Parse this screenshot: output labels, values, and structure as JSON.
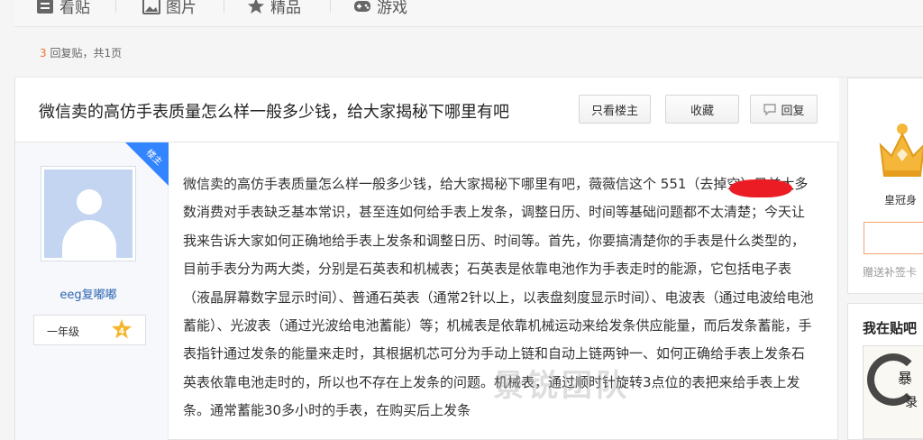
{
  "nav": {
    "items": [
      {
        "label": "看贴",
        "icon": "posts-icon"
      },
      {
        "label": "图片",
        "icon": "image-icon"
      },
      {
        "label": "精品",
        "icon": "star-icon"
      },
      {
        "label": "游戏",
        "icon": "gamepad-icon"
      }
    ]
  },
  "reply_info": {
    "count": "3",
    "text_mid": " 回复贴，共",
    "pages": "1",
    "text_end": "页"
  },
  "thread": {
    "title": "微信卖的高仿手表质量怎么样一般多少钱，给大家揭秘下哪里有吧",
    "buttons": {
      "only_op": "只看楼主",
      "favorite": "收藏",
      "reply": "回复"
    }
  },
  "author": {
    "badge": "楼主",
    "name": "eeg复嘟嘟",
    "level_name": "一年级",
    "level_num": "4"
  },
  "post": {
    "body": "微信卖的高仿手表质量怎么样一般多少钱，给大家揭秘下哪里有吧，薇薇信这个 551（去掉空）目前大多数消费对手表缺乏基本常识，甚至连如何给手表上发条，调整日历、时间等基础问题都不太清楚；今天让我来告诉大家如何正确地给手表上发条和调整日历、时间等。首先，你要搞清楚你的手表是什么类型的，目前手表分为两大类，分别是石英表和机械表；石英表是依靠电池作为手表走时的能源，它包括电子表（液晶屏幕数字显示时间）、普通石英表（通常2针以上，以表盘刻度显示时间）、电波表（通过电波给电池蓄能）、光波表（通过光波给电池蓄能）等；机械表是依靠机械运动来给发条供应能量，而后发条蓄能，手表指针通过发条的能量来走时，其根据机芯可分为手动上链和自动上链两钟一、如何正确给手表上发条石英表依靠电池走时的，所以也不存在上发条的问题。机械表，通过顺时针旋转3点位的表把来给手表上发条。通常蓄能30多小时的手表，在购买后上发条",
    "watermark": "景锐团队"
  },
  "sidebar": {
    "crown_label": "皇冠身",
    "gift_text": "赠送补签卡",
    "section_title": "我在贴吧",
    "thumb_char1": "暴",
    "thumb_char2": "录"
  },
  "colors": {
    "accent_blue": "#3385ff",
    "link_blue": "#2d64b3",
    "highlight_orange": "#f07030",
    "redaction_red": "#ec1c24"
  }
}
